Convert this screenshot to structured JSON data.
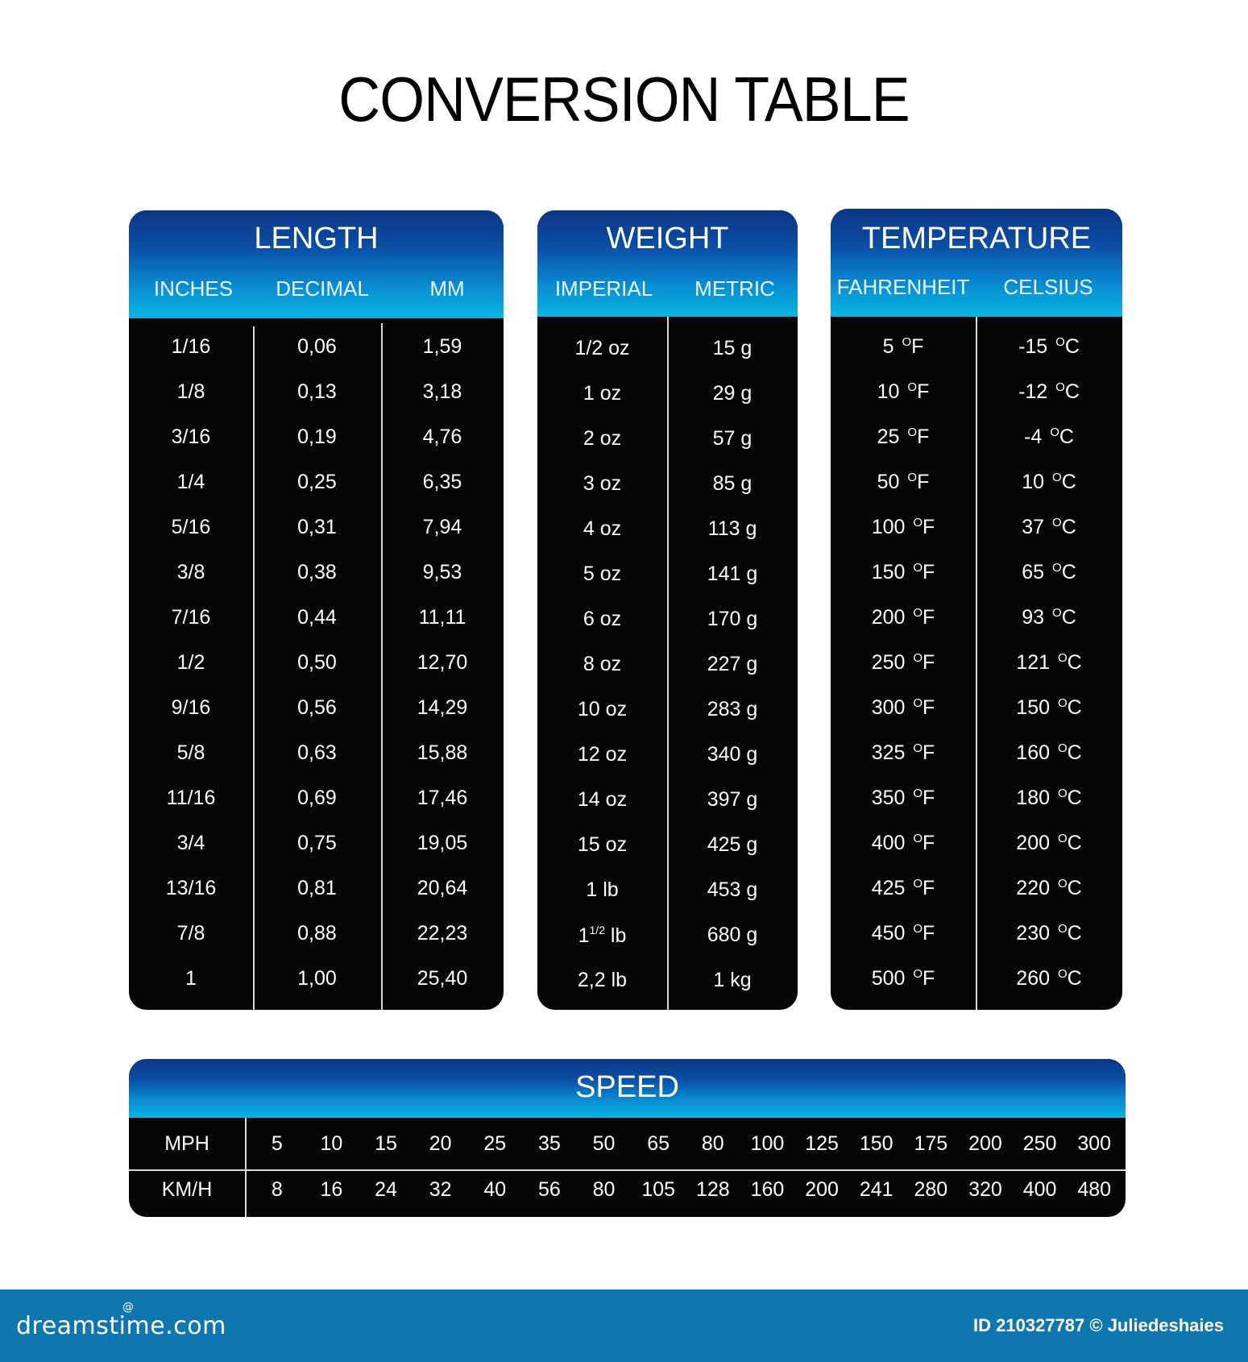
{
  "title": "CONVERSION TABLE",
  "colors": {
    "header_top": "#0c3584",
    "header_bottom": "#0ab6e2",
    "panel_body": "#050505",
    "footer": "#0f76b0"
  },
  "length": {
    "title": "LENGTH",
    "columns": [
      "INCHES",
      "DECIMAL",
      "MM"
    ],
    "rows": [
      [
        "1/16",
        "0,06",
        "1,59"
      ],
      [
        "1/8",
        "0,13",
        "3,18"
      ],
      [
        "3/16",
        "0,19",
        "4,76"
      ],
      [
        "1/4",
        "0,25",
        "6,35"
      ],
      [
        "5/16",
        "0,31",
        "7,94"
      ],
      [
        "3/8",
        "0,38",
        "9,53"
      ],
      [
        "7/16",
        "0,44",
        "11,11"
      ],
      [
        "1/2",
        "0,50",
        "12,70"
      ],
      [
        "9/16",
        "0,56",
        "14,29"
      ],
      [
        "5/8",
        "0,63",
        "15,88"
      ],
      [
        "11/16",
        "0,69",
        "17,46"
      ],
      [
        "3/4",
        "0,75",
        "19,05"
      ],
      [
        "13/16",
        "0,81",
        "20,64"
      ],
      [
        "7/8",
        "0,88",
        "22,23"
      ],
      [
        "1",
        "1,00",
        "25,40"
      ]
    ]
  },
  "weight": {
    "title": "WEIGHT",
    "columns": [
      "IMPERIAL",
      "METRIC"
    ],
    "rows": [
      [
        "1/2 oz",
        "15 g"
      ],
      [
        "1 oz",
        "29 g"
      ],
      [
        "2 oz",
        "57 g"
      ],
      [
        "3 oz",
        "85 g"
      ],
      [
        "4 oz",
        "113 g"
      ],
      [
        "5 oz",
        "141 g"
      ],
      [
        "6 oz",
        "170 g"
      ],
      [
        "8 oz",
        "227 g"
      ],
      [
        "10 oz",
        "283 g"
      ],
      [
        "12 oz",
        "340 g"
      ],
      [
        "14 oz",
        "397 g"
      ],
      [
        "15 oz",
        "425 g"
      ],
      [
        "1 lb",
        "453 g"
      ],
      [
        "1 1/2 lb",
        "680 g"
      ],
      [
        "2,2 lb",
        "1 kg"
      ]
    ]
  },
  "temperature": {
    "title": "TEMPERATURE",
    "columns": [
      "FAHRENHEIT",
      "CELSIUS"
    ],
    "unit_f": "OF",
    "unit_c": "OC",
    "rows": [
      [
        "5",
        "-15"
      ],
      [
        "10",
        "-12"
      ],
      [
        "25",
        "-4"
      ],
      [
        "50",
        "10"
      ],
      [
        "100",
        "37"
      ],
      [
        "150",
        "65"
      ],
      [
        "200",
        "93"
      ],
      [
        "250",
        "121"
      ],
      [
        "300",
        "150"
      ],
      [
        "325",
        "160"
      ],
      [
        "350",
        "180"
      ],
      [
        "400",
        "200"
      ],
      [
        "425",
        "220"
      ],
      [
        "450",
        "230"
      ],
      [
        "500",
        "260"
      ]
    ]
  },
  "speed": {
    "title": "SPEED",
    "row_labels": [
      "MPH",
      "KM/H"
    ],
    "mph": [
      "5",
      "10",
      "15",
      "20",
      "25",
      "35",
      "50",
      "65",
      "80",
      "100",
      "125",
      "150",
      "175",
      "200",
      "250",
      "300"
    ],
    "kmh": [
      "8",
      "16",
      "24",
      "32",
      "40",
      "56",
      "80",
      "105",
      "128",
      "160",
      "200",
      "241",
      "280",
      "320",
      "400",
      "480"
    ]
  },
  "footer": {
    "logo": "dreamstime.com",
    "logo_icon": "swirl-icon",
    "credit": "ID 210327787 © Juliedeshaies"
  }
}
